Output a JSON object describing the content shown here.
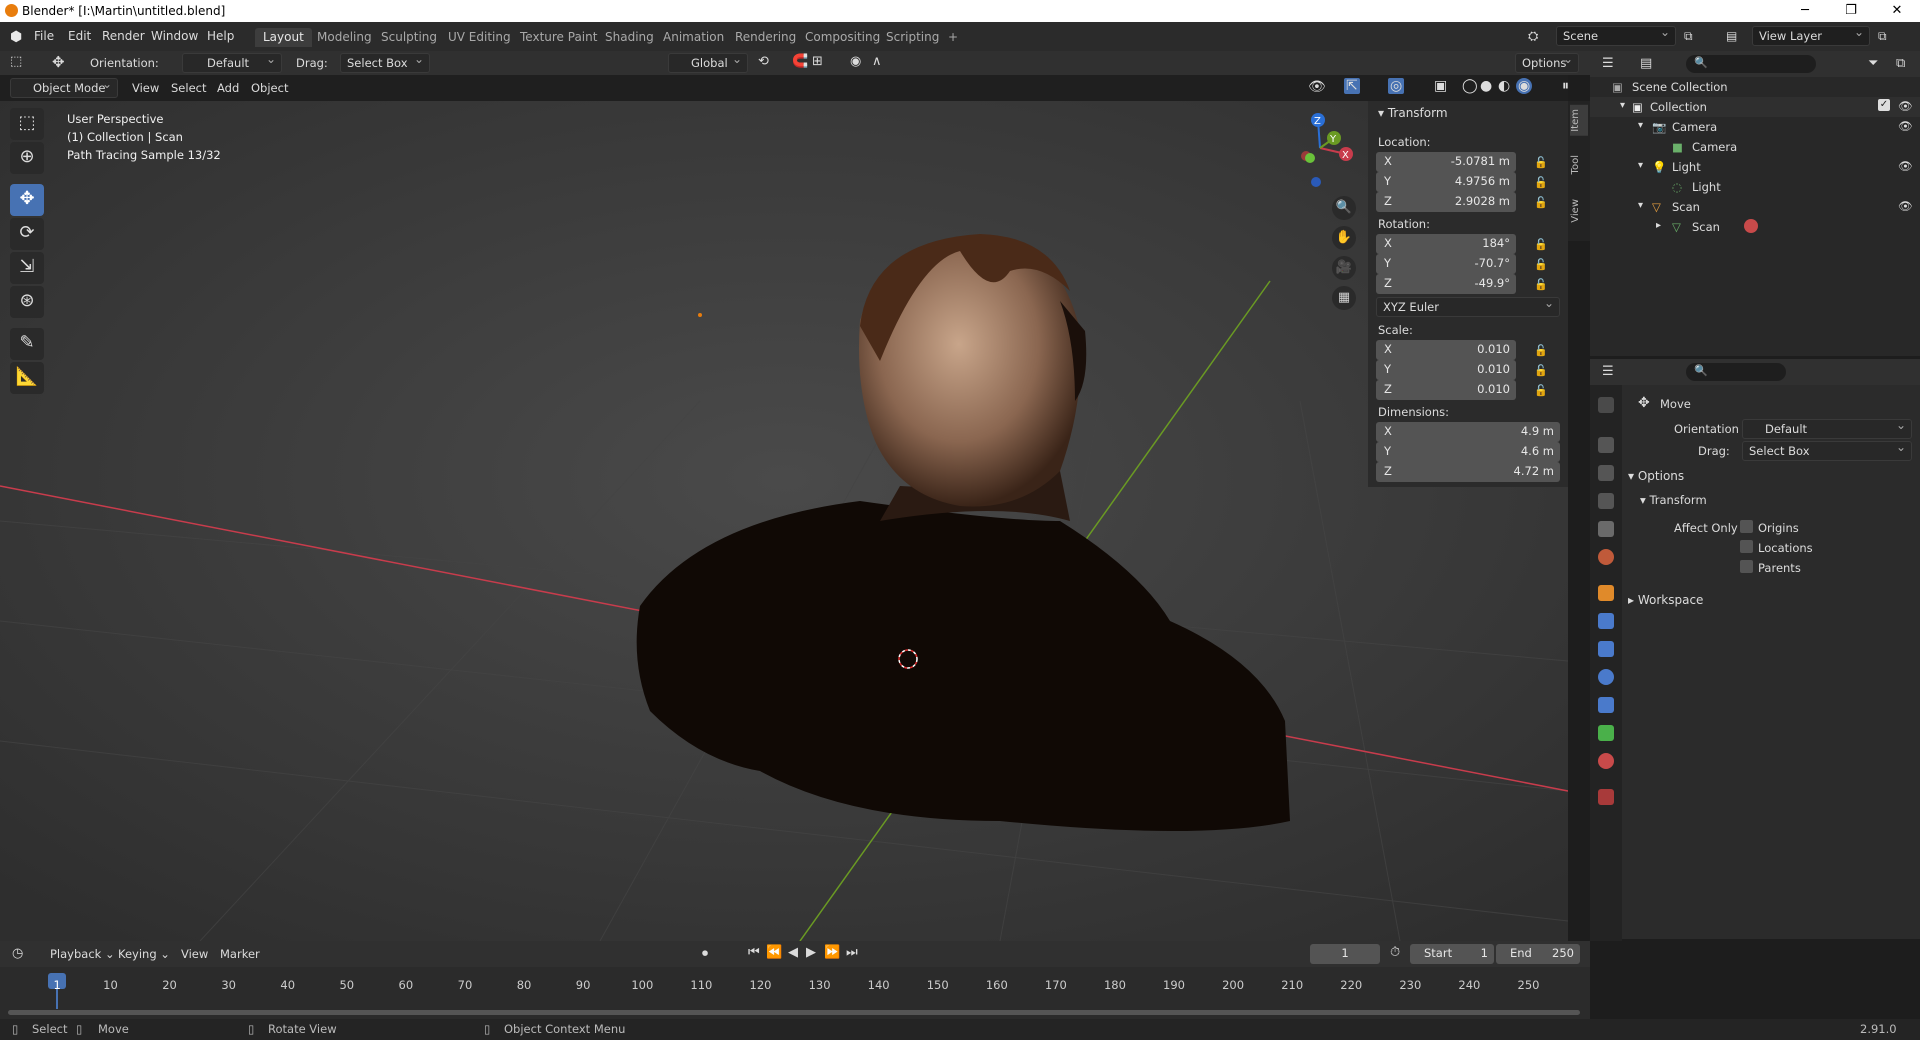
{
  "titlebar": {
    "title": "Blender* [I:\\Martin\\untitled.blend]",
    "minimize": "─",
    "restore": "❐",
    "close": "✕"
  },
  "menu": [
    "File",
    "Edit",
    "Render",
    "Window",
    "Help"
  ],
  "workspaces": [
    "Layout",
    "Modeling",
    "Sculpting",
    "UV Editing",
    "Texture Paint",
    "Shading",
    "Animation",
    "Rendering",
    "Compositing",
    "Scripting",
    "+"
  ],
  "scene": {
    "name": "Scene",
    "view_layer": "View Layer"
  },
  "toolheader": {
    "orientation_label": "Orientation:",
    "orientation_value": "Default",
    "drag_label": "Drag:",
    "drag_value": "Select Box",
    "transform_orientation": "Global",
    "options": "Options"
  },
  "viewport_header": {
    "mode": "Object Mode",
    "view": "View",
    "select": "Select",
    "add": "Add",
    "object": "Object"
  },
  "viewport_info": {
    "line1": "User Perspective",
    "line2": "(1) Collection | Scan",
    "line3": "Path Tracing Sample 13/32"
  },
  "gizmo": {
    "x": "X",
    "y": "Y",
    "z": "Z"
  },
  "npanel": {
    "header": "Transform",
    "location_label": "Location:",
    "location": {
      "x": "-5.0781 m",
      "y": "4.9756 m",
      "z": "2.9028 m"
    },
    "rotation_label": "Rotation:",
    "rotation": {
      "x": "184°",
      "y": "-70.7°",
      "z": "-49.9°"
    },
    "rotation_mode": "XYZ Euler",
    "scale_label": "Scale:",
    "scale": {
      "x": "0.010",
      "y": "0.010",
      "z": "0.010"
    },
    "dimensions_label": "Dimensions:",
    "dimensions": {
      "x": "4.9 m",
      "y": "4.6 m",
      "z": "4.72 m"
    },
    "axis": {
      "x": "X",
      "y": "Y",
      "z": "Z"
    },
    "tabs": {
      "item": "Item",
      "tool": "Tool",
      "view": "View"
    }
  },
  "outliner": {
    "rows": [
      {
        "label": "Scene Collection"
      },
      {
        "label": "Collection"
      },
      {
        "label": "Camera"
      },
      {
        "label": "Camera"
      },
      {
        "label": "Light"
      },
      {
        "label": "Light"
      },
      {
        "label": "Scan"
      },
      {
        "label": "Scan"
      }
    ]
  },
  "properties": {
    "tool_name": "Move",
    "orientation_label": "Orientation",
    "orientation_value": "Default",
    "drag_label": "Drag:",
    "drag_value": "Select Box",
    "options_header": "Options",
    "transform_header": "Transform",
    "affect_only": "Affect Only",
    "checks": [
      "Origins",
      "Locations",
      "Parents"
    ],
    "workspace_header": "Workspace"
  },
  "timeline": {
    "playback": "Playback",
    "keying": "Keying",
    "view": "View",
    "marker": "Marker",
    "current_frame": "1",
    "start_label": "Start",
    "start": "1",
    "end_label": "End",
    "end": "250",
    "ticks": [
      "1",
      "10",
      "20",
      "30",
      "40",
      "50",
      "60",
      "70",
      "80",
      "90",
      "100",
      "110",
      "120",
      "130",
      "140",
      "150",
      "160",
      "170",
      "180",
      "190",
      "200",
      "210",
      "220",
      "230",
      "240",
      "250"
    ]
  },
  "statusbar": {
    "select": "Select",
    "move": "Move",
    "rotate": "Rotate View",
    "context": "Object Context Menu",
    "version": "2.91.0"
  },
  "colors": {
    "accent": "#4772b3",
    "x_axis": "#c83c4c",
    "y_axis": "#6a9a23",
    "z_axis": "#2a6fd6",
    "orange": "#e87d0d"
  }
}
